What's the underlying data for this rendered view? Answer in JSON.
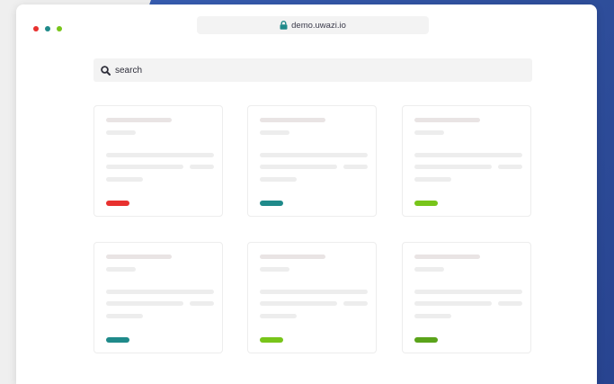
{
  "window": {
    "controls": [
      {
        "name": "close",
        "color": "#e8312f"
      },
      {
        "name": "minimize",
        "color": "#1f8a8a"
      },
      {
        "name": "maximize",
        "color": "#78c51a"
      }
    ]
  },
  "address_bar": {
    "url": "demo.uwazi.io",
    "icon": "lock-icon",
    "icon_color": "#1f8a8a"
  },
  "search": {
    "placeholder": "search",
    "value": "",
    "icon": "search-icon"
  },
  "cards": [
    {
      "tag_color": "#e8312f"
    },
    {
      "tag_color": "#1f8a8a"
    },
    {
      "tag_color": "#78c51a"
    },
    {
      "tag_color": "#1f8a8a"
    },
    {
      "tag_color": "#78c51a"
    },
    {
      "tag_color": "#5aa31a"
    }
  ]
}
